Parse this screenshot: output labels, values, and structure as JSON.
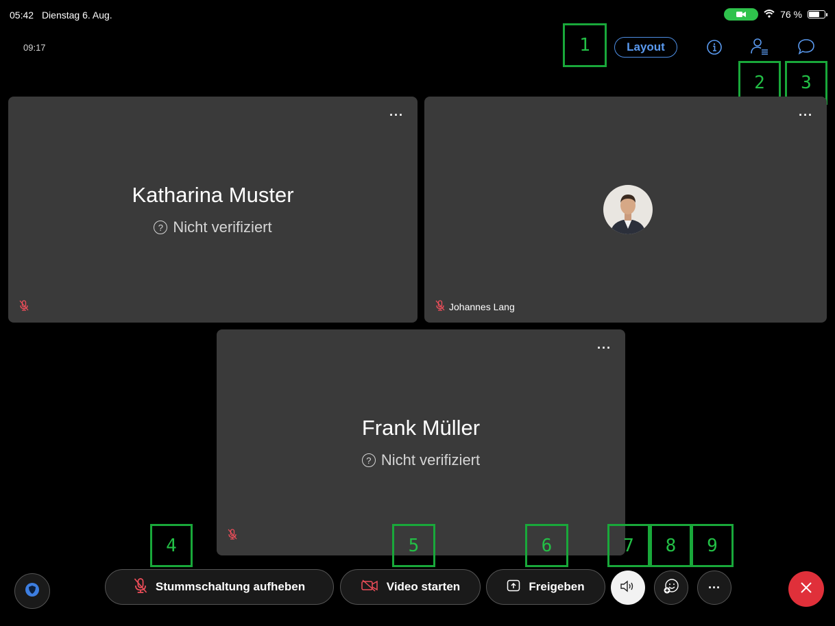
{
  "status_bar": {
    "time": "05:42",
    "date": "Dienstag 6. Aug.",
    "battery": "76 %",
    "battery_level": 0.76
  },
  "call": {
    "elapsed": "09:17"
  },
  "header": {
    "layout_label": "Layout",
    "icons": [
      "info-icon",
      "participants-icon",
      "chat-icon"
    ]
  },
  "annotations": [
    "1",
    "2",
    "3",
    "4",
    "5",
    "6",
    "7",
    "8",
    "9"
  ],
  "tiles": [
    {
      "name": "Katharina Muster",
      "status": "Nicht verifiziert",
      "muted": true
    },
    {
      "name": "Johannes Lang",
      "muted": true,
      "has_photo": true
    },
    {
      "name": "Frank Müller",
      "status": "Nicht verifiziert",
      "muted": true
    }
  ],
  "tile_menu_label": "···",
  "toolbar": {
    "unmute_label": "Stummschaltung aufheben",
    "video_label": "Video starten",
    "share_label": "Freigeben",
    "more_label": "···"
  },
  "colors": {
    "accent": "#4e8fe6",
    "annotation": "#19a83a",
    "muted_red": "#f04e5a",
    "end_call": "#e0303a",
    "tile_bg": "#3a3a3a"
  }
}
